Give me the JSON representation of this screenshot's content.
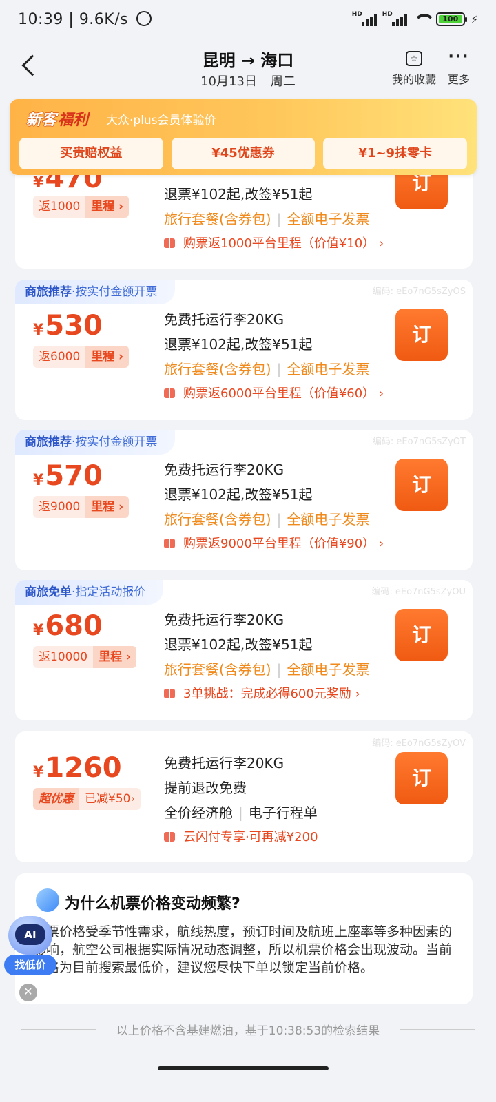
{
  "status_bar": {
    "time": "10:39",
    "speed": "9.6K/s",
    "battery": "100",
    "sim1": "HD",
    "sim2": "HD"
  },
  "nav": {
    "title": "昆明 → 海口",
    "date": "10月13日",
    "weekday": "周二",
    "favorites_label": "我的收藏",
    "more_label": "更多"
  },
  "promo": {
    "title_a": "新客",
    "title_b": "福利",
    "subtitle": "大众·plus会员体验价",
    "buttons": [
      "买贵赔权益",
      "¥45优惠券",
      "¥1~9抹零卡"
    ]
  },
  "cards": [
    {
      "price": "470",
      "mile_a": "返1000",
      "mile_b": "里程 ›",
      "lines": [
        "退票¥102起,改签¥51起"
      ],
      "pkg_a": "旅行套餐(含券包)",
      "pkg_b": "全额电子发票",
      "promo": "购票返1000平台里程（价值¥10） ›",
      "book": "订"
    },
    {
      "tag_a": "商旅推荐",
      "tag_b": "·按实付金额开票",
      "code": "编码: eEo7nG5sZyOS",
      "price": "530",
      "mile_a": "返6000",
      "mile_b": "里程 ›",
      "lines": [
        "免费托运行李20KG",
        "退票¥102起,改签¥51起"
      ],
      "pkg_a": "旅行套餐(含券包)",
      "pkg_b": "全额电子发票",
      "promo": "购票返6000平台里程（价值¥60） ›",
      "book": "订"
    },
    {
      "tag_a": "商旅推荐",
      "tag_b": "·按实付金额开票",
      "code": "编码: eEo7nG5sZyOT",
      "price": "570",
      "mile_a": "返9000",
      "mile_b": "里程 ›",
      "lines": [
        "免费托运行李20KG",
        "退票¥102起,改签¥51起"
      ],
      "pkg_a": "旅行套餐(含券包)",
      "pkg_b": "全额电子发票",
      "promo": "购票返9000平台里程（价值¥90） ›",
      "book": "订"
    },
    {
      "tag_a": "商旅免单",
      "tag_b": "·指定活动报价",
      "code": "编码: eEo7nG5sZyOU",
      "price": "680",
      "mile_a": "返10000",
      "mile_b": "里程 ›",
      "lines": [
        "免费托运行李20KG",
        "退票¥102起,改签¥51起"
      ],
      "pkg_a": "旅行套餐(含券包)",
      "pkg_b": "全额电子发票",
      "promo": "3单挑战：完成必得600元奖励 ›",
      "book": "订"
    },
    {
      "code": "编码: eEo7nG5sZyOV",
      "price": "1260",
      "mile_a": "超优惠",
      "mile_b": "已减¥50›",
      "lines": [
        "免费托运行李20KG",
        "提前退改免费"
      ],
      "pkg_a": "全价经济舱",
      "pkg_b": "电子行程单",
      "promo": "云闪付专享·可再减¥200",
      "book": "订"
    }
  ],
  "info": {
    "heading": "为什么机票价格变动频繁?",
    "body": "机票价格受季节性需求，航线热度，预订时间及航班上座率等多种因素的影响，航空公司根据实际情况动态调整，所以机票价格会出现波动。当前价格为目前搜索最低价，建议您尽快下单以锁定当前价格。"
  },
  "ai": {
    "face": "AI",
    "label": "找低价"
  },
  "footer": "以上价格不含基建燃油，基于10:38:53的检索结果"
}
